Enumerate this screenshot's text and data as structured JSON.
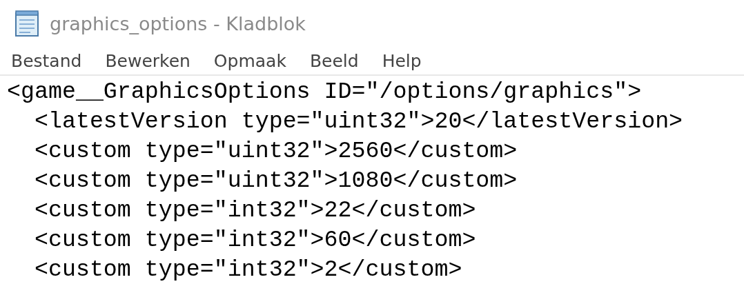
{
  "window": {
    "title": "graphics_options - Kladblok"
  },
  "menu": [
    "Bestand",
    "Bewerken",
    "Opmaak",
    "Beeld",
    "Help"
  ],
  "editor": {
    "lines": [
      "<game__GraphicsOptions ID=\"/options/graphics\">",
      "  <latestVersion type=\"uint32\">20</latestVersion>",
      "  <custom type=\"uint32\">2560</custom>",
      "  <custom type=\"uint32\">1080</custom>",
      "  <custom type=\"int32\">22</custom>",
      "  <custom type=\"int32\">60</custom>",
      "  <custom type=\"int32\">2</custom>"
    ]
  }
}
